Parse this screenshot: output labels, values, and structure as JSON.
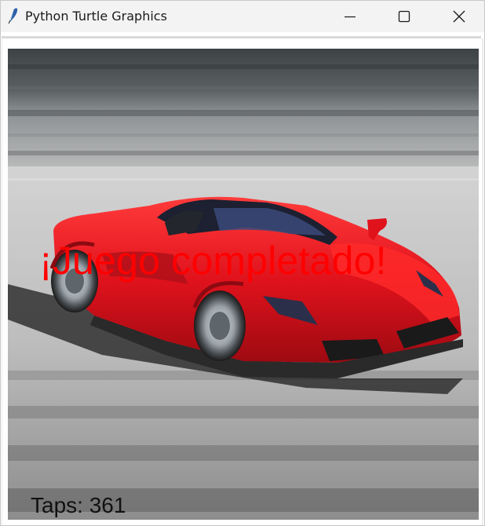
{
  "window": {
    "title": "Python Turtle Graphics",
    "app_icon": "feather-icon",
    "controls": [
      "minimize-icon",
      "maximize-icon",
      "close-icon"
    ]
  },
  "canvas": {
    "background_image": "red-sports-car-on-blurred-road",
    "message": "¡Juego completado!",
    "message_color": "#ff0000",
    "taps_label": "Taps: 361"
  }
}
